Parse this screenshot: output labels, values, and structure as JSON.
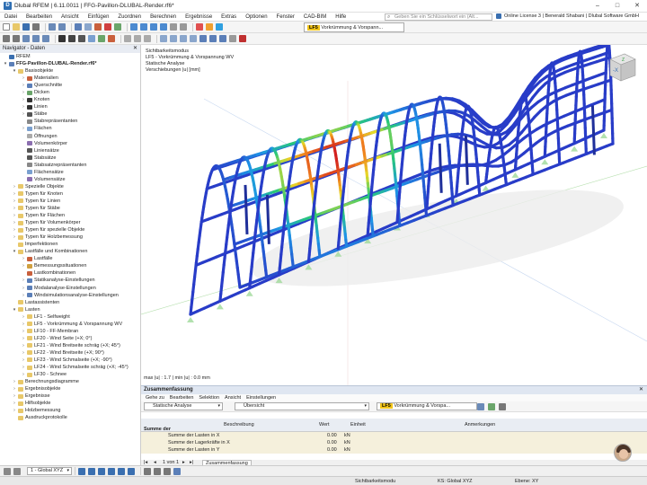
{
  "window": {
    "title": "Dlubal RFEM | 6.11.0011 | FFG-Pavillon-DLUBAL-Render.rf6*",
    "controls": [
      "–",
      "□",
      "✕"
    ]
  },
  "menu": [
    "Datei",
    "Bearbeiten",
    "Ansicht",
    "Einfügen",
    "Zuordnen",
    "Berechnen",
    "Ergebnisse",
    "Extras",
    "Optionen",
    "Fenster",
    "CAD-BIM",
    "Hilfe"
  ],
  "search": {
    "placeholder": "Geben Sie ein Schlüsselwort ein (Alt..."
  },
  "license": {
    "text": "Online License 3 | Benerald Shabani | Dlubal Software GmbH"
  },
  "load_case": {
    "tag": "LF5",
    "name": "Vorkrümmung & Vorspann..."
  },
  "navigator": {
    "title": "Navigator - Daten",
    "items": [
      {
        "label": "RFEM",
        "depth": 0,
        "exp": "",
        "icon": "rfem-icon",
        "color": "#3a6fb0"
      },
      {
        "label": "FFG-Pavillon-DLUBAL-Render.rf6*",
        "depth": 0,
        "exp": "▾",
        "icon": "model-icon",
        "color": "#5b7fb8",
        "bold": true
      },
      {
        "label": "Basisobjekte",
        "depth": 1,
        "exp": "▾",
        "icon": "folder-icon",
        "color": "#e8c86a"
      },
      {
        "label": "Materialien",
        "depth": 2,
        "exp": "›",
        "icon": "material-icon",
        "color": "#c9603c"
      },
      {
        "label": "Querschnitte",
        "depth": 2,
        "exp": "›",
        "icon": "section-icon",
        "color": "#5b7fb8"
      },
      {
        "label": "Dicken",
        "depth": 2,
        "exp": "›",
        "icon": "thickness-icon",
        "color": "#6aa56a"
      },
      {
        "label": "Knoten",
        "depth": 2,
        "exp": "›",
        "icon": "node-icon",
        "color": "#333333"
      },
      {
        "label": "Linien",
        "depth": 2,
        "exp": "›",
        "icon": "line-icon",
        "color": "#333333"
      },
      {
        "label": "Stäbe",
        "depth": 2,
        "exp": "›",
        "icon": "member-icon",
        "color": "#555555"
      },
      {
        "label": "Stabrepräsentanten",
        "depth": 2,
        "exp": "",
        "icon": "member-rep-icon",
        "color": "#888888"
      },
      {
        "label": "Flächen",
        "depth": 2,
        "exp": "›",
        "icon": "surface-icon",
        "color": "#7aa0d0"
      },
      {
        "label": "Öffnungen",
        "depth": 2,
        "exp": "",
        "icon": "opening-icon",
        "color": "#aaaaaa"
      },
      {
        "label": "Volumenkörper",
        "depth": 2,
        "exp": "",
        "icon": "solid-icon",
        "color": "#8c6fb0"
      },
      {
        "label": "Liniensätze",
        "depth": 2,
        "exp": "",
        "icon": "lineset-icon",
        "color": "#555555"
      },
      {
        "label": "Stabsätze",
        "depth": 2,
        "exp": "",
        "icon": "memberset-icon",
        "color": "#555555"
      },
      {
        "label": "Stabsatzrepräsentanten",
        "depth": 2,
        "exp": "",
        "icon": "memberset-rep-icon",
        "color": "#888888"
      },
      {
        "label": "Flächensätze",
        "depth": 2,
        "exp": "",
        "icon": "surfaceset-icon",
        "color": "#7aa0d0"
      },
      {
        "label": "Volumensätze",
        "depth": 2,
        "exp": "",
        "icon": "solidset-icon",
        "color": "#8c6fb0"
      },
      {
        "label": "Spezielle Objekte",
        "depth": 1,
        "exp": "›",
        "icon": "folder-icon",
        "color": "#e8c86a"
      },
      {
        "label": "Typen für Knoten",
        "depth": 1,
        "exp": "›",
        "icon": "folder-icon",
        "color": "#e8c86a"
      },
      {
        "label": "Typen für Linien",
        "depth": 1,
        "exp": "›",
        "icon": "folder-icon",
        "color": "#e8c86a"
      },
      {
        "label": "Typen für Stäbe",
        "depth": 1,
        "exp": "›",
        "icon": "folder-icon",
        "color": "#e8c86a"
      },
      {
        "label": "Typen für Flächen",
        "depth": 1,
        "exp": "›",
        "icon": "folder-icon",
        "color": "#e8c86a"
      },
      {
        "label": "Typen für Volumenkörper",
        "depth": 1,
        "exp": "›",
        "icon": "folder-icon",
        "color": "#e8c86a"
      },
      {
        "label": "Typen für spezielle Objekte",
        "depth": 1,
        "exp": "›",
        "icon": "folder-icon",
        "color": "#e8c86a"
      },
      {
        "label": "Typen für Holzbemessung",
        "depth": 1,
        "exp": "›",
        "icon": "folder-icon",
        "color": "#e8c86a"
      },
      {
        "label": "Imperfektionen",
        "depth": 1,
        "exp": "",
        "icon": "folder-icon",
        "color": "#e8c86a"
      },
      {
        "label": "Lastfälle und Kombinationen",
        "depth": 1,
        "exp": "▾",
        "icon": "folder-icon",
        "color": "#e8c86a"
      },
      {
        "label": "Lastfälle",
        "depth": 2,
        "exp": "›",
        "icon": "loadcase-icon",
        "color": "#c9603c"
      },
      {
        "label": "Bemessungssituationen",
        "depth": 2,
        "exp": "›",
        "icon": "design-situation-icon",
        "color": "#d0a040"
      },
      {
        "label": "Lastkombinationen",
        "depth": 2,
        "exp": "",
        "icon": "load-combination-icon",
        "color": "#c9603c"
      },
      {
        "label": "Statikanalyse-Einstellungen",
        "depth": 2,
        "exp": "›",
        "icon": "static-settings-icon",
        "color": "#5b7fb8"
      },
      {
        "label": "Modalanalyse-Einstellungen",
        "depth": 2,
        "exp": "›",
        "icon": "modal-settings-icon",
        "color": "#5b7fb8"
      },
      {
        "label": "Windsimulationsanalyse-Einstellungen",
        "depth": 2,
        "exp": "›",
        "icon": "wind-settings-icon",
        "color": "#5b7fb8"
      },
      {
        "label": "Lastassistenten",
        "depth": 1,
        "exp": "",
        "icon": "folder-icon",
        "color": "#e8c86a"
      },
      {
        "label": "Lasten",
        "depth": 1,
        "exp": "▾",
        "icon": "folder-icon",
        "color": "#e8c86a"
      },
      {
        "label": "LF1 - Selfweight",
        "depth": 2,
        "exp": "›",
        "icon": "folder-icon",
        "color": "#e8c86a"
      },
      {
        "label": "LF5 - Vorkrümmung & Vorspannung WV",
        "depth": 2,
        "exp": "›",
        "icon": "folder-icon",
        "color": "#e8c86a"
      },
      {
        "label": "LF10 - FF-Membran",
        "depth": 2,
        "exp": "›",
        "icon": "folder-icon",
        "color": "#e8c86a"
      },
      {
        "label": "LF20 - Wind Seite (+X; 0°)",
        "depth": 2,
        "exp": "›",
        "icon": "folder-icon",
        "color": "#e8c86a"
      },
      {
        "label": "LF21 - Wind Breitseite schräg (+X; 45°)",
        "depth": 2,
        "exp": "›",
        "icon": "folder-icon",
        "color": "#e8c86a"
      },
      {
        "label": "LF22 - Wind Breitseite (+X; 90°)",
        "depth": 2,
        "exp": "›",
        "icon": "folder-icon",
        "color": "#e8c86a"
      },
      {
        "label": "LF23 - Wind Schmalseite (+X; -90°)",
        "depth": 2,
        "exp": "›",
        "icon": "folder-icon",
        "color": "#e8c86a"
      },
      {
        "label": "LF24 - Wind Schmalseite schräg (+X; -45°)",
        "depth": 2,
        "exp": "›",
        "icon": "folder-icon",
        "color": "#e8c86a"
      },
      {
        "label": "LF30 - Schnee",
        "depth": 2,
        "exp": "›",
        "icon": "folder-icon",
        "color": "#e8c86a"
      },
      {
        "label": "Berechnungsdiagramme",
        "depth": 1,
        "exp": "›",
        "icon": "folder-icon",
        "color": "#e8c86a"
      },
      {
        "label": "Ergebnisobjekte",
        "depth": 1,
        "exp": "›",
        "icon": "folder-icon",
        "color": "#e8c86a"
      },
      {
        "label": "Ergebnisse",
        "depth": 1,
        "exp": "›",
        "icon": "folder-icon",
        "color": "#e8c86a"
      },
      {
        "label": "Hilfsobjekte",
        "depth": 1,
        "exp": "›",
        "icon": "folder-icon",
        "color": "#e8c86a"
      },
      {
        "label": "Holzbemessung",
        "depth": 1,
        "exp": "›",
        "icon": "folder-icon",
        "color": "#e8c86a"
      },
      {
        "label": "Ausdruckprotokolle",
        "depth": 1,
        "exp": "",
        "icon": "folder-icon",
        "color": "#e8c86a"
      }
    ]
  },
  "viewport": {
    "info_lines": [
      "Sichtbarkeitsmodus",
      "LF5 - Vorkrümmung & Vorspannung WV",
      "Statische Analyse",
      "Verschiebungen |u| [mm]"
    ],
    "max_min": "max |u| : 1.7 | min |u| : 0.0 mm",
    "cube_labels": {
      "front": "-X",
      "top": "Z"
    }
  },
  "summary": {
    "title": "Zusammenfassung",
    "menu": [
      "Gehe zu",
      "Bearbeiten",
      "Selektion",
      "Ansicht",
      "Einstellungen"
    ],
    "analysis_dropdown": "Statische Analyse",
    "view_dropdown": "Übersicht",
    "lc_tag": "LF5",
    "lc_name": "Vorkrümmung & Vorspa...",
    "columns": [
      "Beschreibung",
      "Wert",
      "Einheit",
      "Anmerkungen"
    ],
    "group_label": "Summe der Lasten und Summe der Lagerkräfte",
    "rows": [
      {
        "desc": "Summe der Lasten in X",
        "value": "0.00",
        "unit": "kN"
      },
      {
        "desc": "Summe der Lagerkräfte in X",
        "value": "0.00",
        "unit": "kN"
      },
      {
        "desc": "Summe der Lasten in Y",
        "value": "0.00",
        "unit": "kN"
      }
    ],
    "pager": "1 von 1",
    "tab": "Zusammenfassung"
  },
  "bottom_toolbar": {
    "coord_system": "1 - Global XYZ"
  },
  "status": {
    "mode": "Sichtbarkeitsmodu",
    "ks": "KS: Global XYZ",
    "plane": "Ebene: XY"
  }
}
